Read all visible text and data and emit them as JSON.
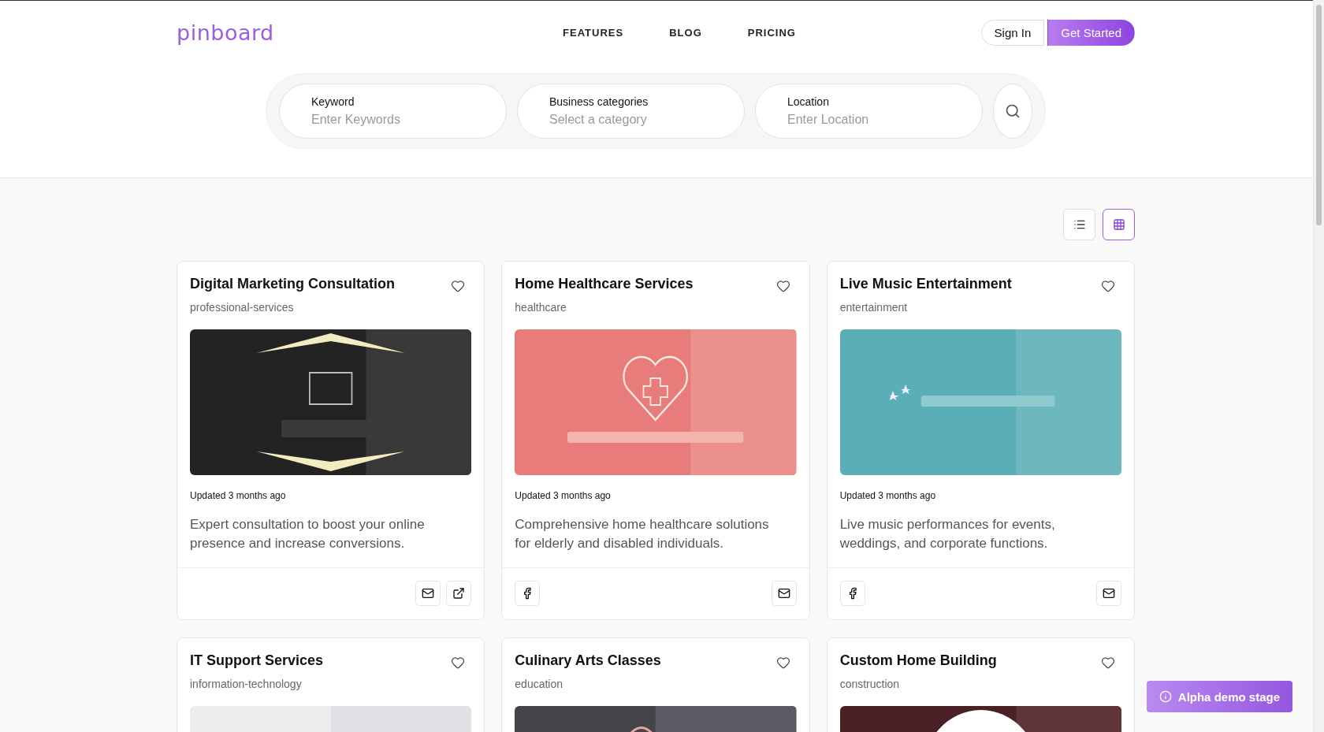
{
  "logo": "pinboard",
  "nav": [
    "FEATURES",
    "BLOG",
    "PRICING"
  ],
  "auth": [
    {
      "label": "Sign In",
      "kind": "outline"
    },
    {
      "label": "Get Started",
      "kind": "primary"
    }
  ],
  "search": {
    "fields": [
      {
        "label": "Keyword",
        "placeholder": "Enter Keywords"
      },
      {
        "label": "Business categories",
        "placeholder": "Select a category"
      },
      {
        "label": "Location",
        "placeholder": "Enter Location"
      }
    ]
  },
  "view_toggle": [
    {
      "kind": "list",
      "selected": false
    },
    {
      "kind": "grid",
      "selected": true
    }
  ],
  "listings": [
    {
      "title": "Digital Marketing Consultation",
      "category": "professional-services",
      "image": {
        "kind": "picture"
      },
      "updated": "Updated 3 months ago",
      "description": "Expert consultation to boost your online presence and increase conversions.",
      "actions_right": [
        {
          "kind": "mail"
        },
        {
          "kind": "external"
        }
      ]
    },
    {
      "title": "Home Healthcare Services",
      "category": "healthcare",
      "image": {
        "kind": "picture"
      },
      "updated": "Updated 3 months ago",
      "description": "Comprehensive home healthcare solutions for elderly and disabled individuals.",
      "actions_left": [
        {
          "kind": "facebook"
        }
      ],
      "actions_right": [
        {
          "kind": "mail"
        }
      ]
    },
    {
      "title": "Live Music Entertainment",
      "category": "entertainment",
      "image": {
        "kind": "picture"
      },
      "updated": "Updated 3 months ago",
      "description": "Live music performances for events, weddings, and corporate functions.",
      "actions_left": [
        {
          "kind": "facebook"
        }
      ],
      "actions_right": [
        {
          "kind": "mail"
        }
      ]
    },
    {
      "title": "IT Support Services",
      "category": "information-technology",
      "image": {
        "kind": "picture"
      }
    },
    {
      "title": "Culinary Arts Classes",
      "category": "education",
      "image": {
        "kind": "picture"
      }
    },
    {
      "title": "Custom Home Building",
      "category": "construction",
      "image": {
        "kind": "picture"
      }
    }
  ],
  "badge": {
    "label": "Alpha demo stage"
  }
}
